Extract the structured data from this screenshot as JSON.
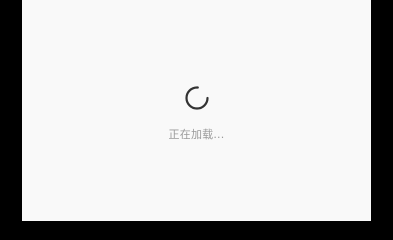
{
  "loading": {
    "message": "正在加载...",
    "icon": "loading-spinner-icon"
  },
  "colors": {
    "background": "#f9f9f9",
    "letterbox": "#000000",
    "spinner": "#333333",
    "text": "#9a9a9a"
  }
}
